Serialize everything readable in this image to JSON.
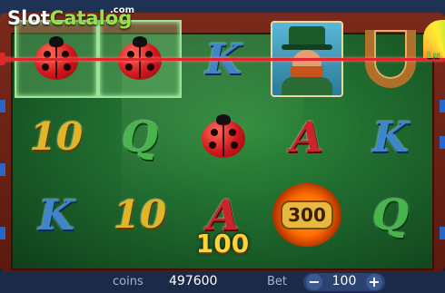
{
  "logo": {
    "slot": "Slot",
    "catalog": "Catalog",
    "com": ".com"
  },
  "reels": [
    [
      "ladybug",
      "10",
      "K"
    ],
    [
      "ladybug",
      "Q",
      "10"
    ],
    [
      "K",
      "ladybug",
      "A"
    ],
    [
      "leprechaun",
      "A",
      "coin"
    ],
    [
      "horseshoe",
      "K",
      "Q"
    ]
  ],
  "winning_cells": [
    [
      0,
      0
    ],
    [
      1,
      0
    ]
  ],
  "coin_symbol_value": "300",
  "win_amount": "100",
  "corner_badge": "Lu",
  "bottom_bar": {
    "coins_label": "coins",
    "coins_value": "497600",
    "bet_label": "Bet",
    "bet_minus": "−",
    "bet_value": "100",
    "bet_plus": "+"
  },
  "colors": {
    "payline": "#e0262a",
    "win_amount": "#ffd23c"
  },
  "icons": {
    "minus": "minus-icon",
    "plus": "plus-icon"
  }
}
